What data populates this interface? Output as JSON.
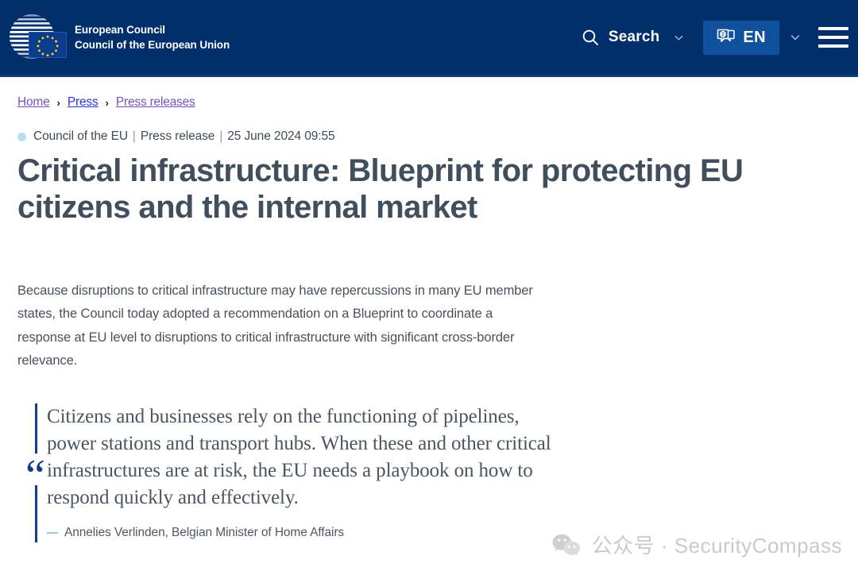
{
  "header": {
    "brand": {
      "line1": "European Council",
      "line2": "Council of the European Union",
      "logo_icon": "european-council-logo",
      "flag_icon": "eu-flag-icon"
    },
    "search": {
      "label": "Search",
      "icon": "search-icon",
      "chevron_icon": "chevron-down-icon"
    },
    "language": {
      "label": "EN",
      "icon": "language-speech-bubble-icon",
      "chevron_icon": "chevron-down-icon",
      "background": "#10519e"
    },
    "menu": {
      "icon": "hamburger-menu-icon"
    },
    "background": "#002f6c"
  },
  "breadcrumb": {
    "items": [
      {
        "label": "Home",
        "state": "visited"
      },
      {
        "label": "Press",
        "state": "link"
      },
      {
        "label": "Press releases",
        "state": "visited"
      }
    ],
    "separator": "›"
  },
  "article": {
    "meta": {
      "dot_color": "#b7dff0",
      "source": "Council of the EU",
      "type": "Press release",
      "datetime": "25 June 2024 09:55",
      "separator": "|"
    },
    "title": "Critical infrastructure: Blueprint for protecting EU citizens and the internal market",
    "lead": "Because disruptions to critical infrastructure may have repercussions in many EU member states, the Council today adopted a recommendation on a Blueprint to coordinate a response at EU level to disruptions to critical infrastructure with significant cross-border relevance.",
    "quote": {
      "mark": "“",
      "text": "Citizens and businesses rely on the functioning of pipelines, power stations and transport hubs. When these and other critical infrastructures are at risk, the EU needs a playbook on how to respond quickly and effectively.",
      "attribution": "Annelies Verlinden, Belgian Minister of Home Affairs",
      "bar_color": "#123c8c"
    }
  },
  "watermark": {
    "icon": "wechat-icon",
    "text": "公众号 · SecurityCompass"
  }
}
